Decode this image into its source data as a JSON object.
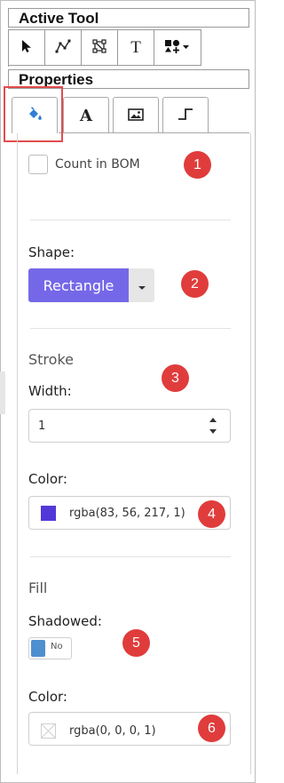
{
  "active_tool": {
    "title": "Active Tool",
    "tools": [
      {
        "name": "select",
        "icon": "arrow-pointer-icon",
        "active": true
      },
      {
        "name": "path",
        "icon": "path-nodes-icon"
      },
      {
        "name": "transform",
        "icon": "transform-box-icon"
      },
      {
        "name": "text",
        "icon": "text-tool-icon",
        "glyph": "T"
      },
      {
        "name": "shapes",
        "icon": "shapes-dropdown-icon"
      }
    ]
  },
  "properties": {
    "title": "Properties",
    "tabs": [
      {
        "id": "fill",
        "icon": "paint-bucket-icon",
        "active": true
      },
      {
        "id": "text",
        "icon": "text-format-icon",
        "glyph": "A"
      },
      {
        "id": "image",
        "icon": "image-icon"
      },
      {
        "id": "line",
        "icon": "line-connector-icon"
      }
    ]
  },
  "form": {
    "count_in_bom_label": "Count in BOM",
    "count_in_bom_checked": false,
    "shape_label": "Shape:",
    "shape_value": "Rectangle",
    "stroke_heading": "Stroke",
    "width_label": "Width:",
    "width_value": "1",
    "stroke_color_label": "Color:",
    "stroke_color_value": "rgba(83, 56, 217, 1)",
    "fill_heading": "Fill",
    "shadowed_label": "Shadowed:",
    "shadowed_value": "No",
    "fill_color_label": "Color:",
    "fill_color_value": "rgba(0, 0, 0, 1)"
  },
  "badges": [
    "1",
    "2",
    "3",
    "4",
    "5",
    "6"
  ],
  "colors": {
    "accent": "#7468e8",
    "stroke_swatch": "#5338d9",
    "badge": "#e03c3c",
    "highlight": "#e24c4c",
    "toggle_knob": "#4e8fd0"
  }
}
